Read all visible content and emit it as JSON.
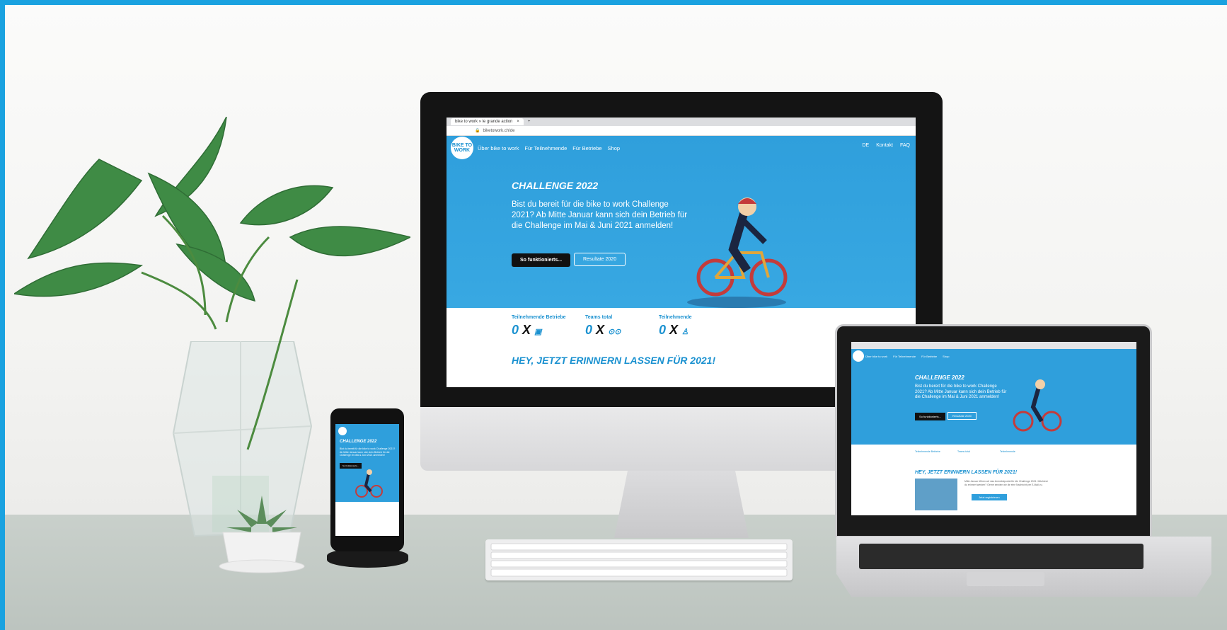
{
  "browser": {
    "tab_title": "bike to work » le grande action",
    "url": "biketowork.ch/de"
  },
  "site": {
    "logo_text": "BIKE TO WORK",
    "nav": {
      "items": [
        "Über bike to work",
        "Für Teilnehmende",
        "Für Betriebe",
        "Shop"
      ],
      "right": [
        "DE",
        "Kontakt",
        "FAQ"
      ]
    },
    "hero": {
      "title": "CHALLENGE 2022",
      "text": "Bist du bereit für die bike to work Challenge 2021? Ab Mitte Januar kann sich dein Betrieb für die Challenge im Mai & Juni 2021 anmelden!",
      "primary_button": "So funktionierts...",
      "secondary_button": "Resultate 2020"
    },
    "stats": [
      {
        "label": "Teilnehmende Betriebe",
        "value": "0",
        "suffix": "X",
        "icon": "briefcase-icon"
      },
      {
        "label": "Teams total",
        "value": "0",
        "suffix": "X",
        "icon": "bicycle-icon"
      },
      {
        "label": "Teilnehmende",
        "value": "0",
        "suffix": "X",
        "icon": "person-icon"
      }
    ],
    "reminder": {
      "title": "HEY, JETZT ERINNERN LASSEN FÜR 2021!",
      "text": "Mitte Januar öffnen wir das Anmeldeportal für die Challenge 2021. Möchtest du erinnert werden? Gerne senden wir dir eine Nachricht per E-Mail zu.",
      "button": "Jetzt registrieren"
    }
  },
  "colors": {
    "brand_blue": "#2f9fdc",
    "frame_blue": "#1aa2e0",
    "dark": "#111111"
  }
}
